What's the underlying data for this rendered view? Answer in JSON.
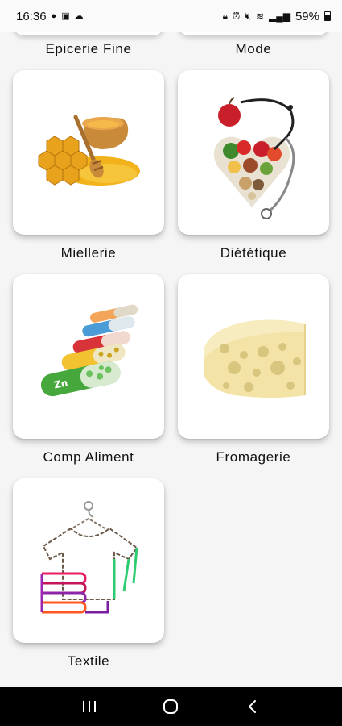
{
  "status_bar": {
    "time": "16:36",
    "battery": "59%",
    "left_icons": [
      "messenger-icon",
      "gallery-icon",
      "cloud-icon"
    ],
    "right_icons": [
      "lock-icon",
      "alarm-icon",
      "mute-icon",
      "wifi-icon",
      "signal-icon"
    ]
  },
  "categories": {
    "top_left": "Epicerie Fine",
    "top_right": "Mode",
    "items": [
      {
        "label": "Miellerie",
        "icon": "honey-icon"
      },
      {
        "label": "Diététique",
        "icon": "heart-stethoscope-icon"
      },
      {
        "label": "Comp Aliment",
        "icon": "vitamin-capsules-icon"
      },
      {
        "label": "Fromagerie",
        "icon": "cheese-icon"
      },
      {
        "label": "Textile",
        "icon": "tshirt-hanger-icon"
      }
    ]
  },
  "nav": {
    "buttons": [
      "recent-apps-button",
      "home-button",
      "back-button"
    ]
  }
}
